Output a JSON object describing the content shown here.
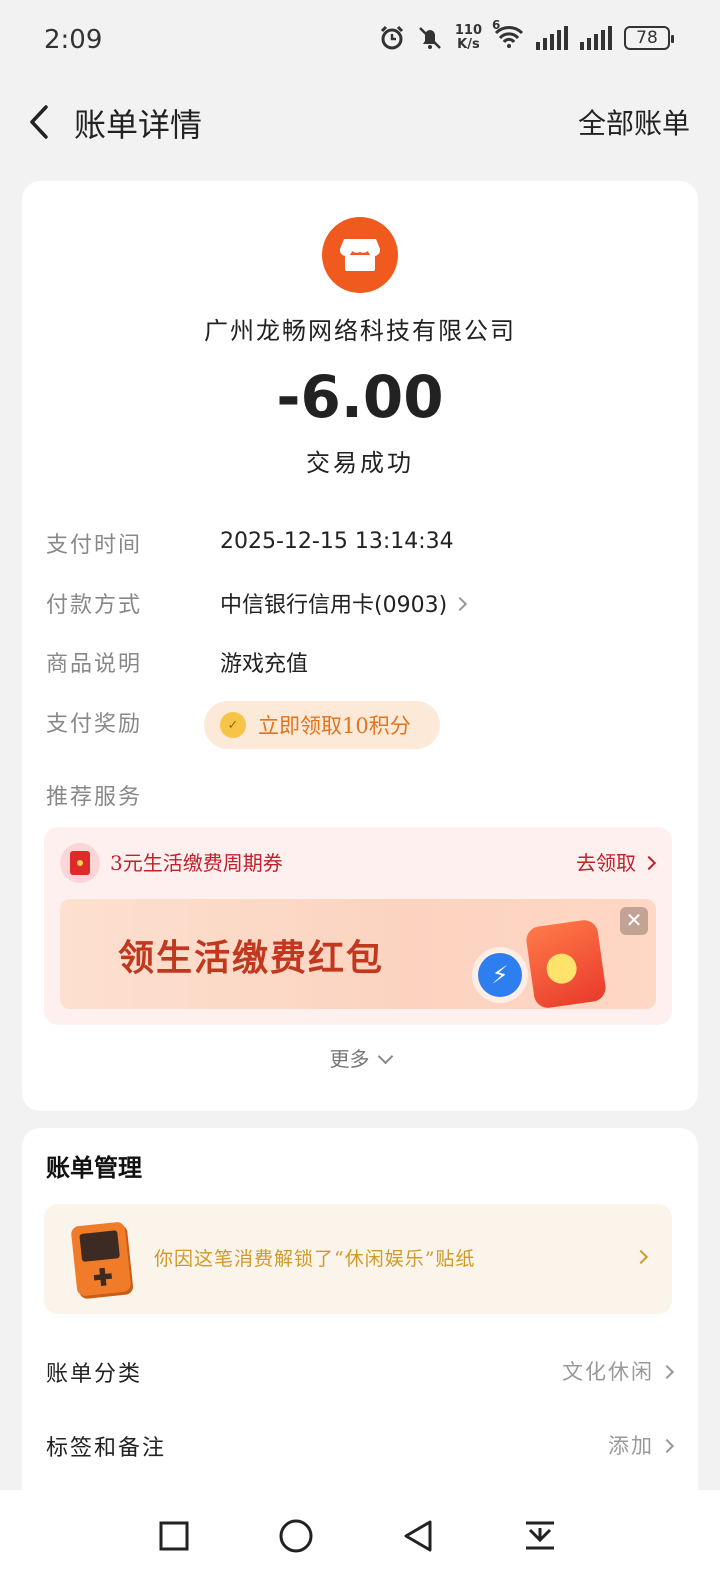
{
  "status_bar": {
    "time": "2:09",
    "net_speed_value": "110",
    "net_speed_unit": "K/s",
    "net_type": "6",
    "battery": "78"
  },
  "header": {
    "title": "账单详情",
    "all_bills": "全部账单"
  },
  "transaction": {
    "merchant": "广州龙畅网络科技有限公司",
    "amount": "-6.00",
    "status": "交易成功",
    "rows": [
      {
        "label": "支付时间",
        "value": "2025-12-15 13:14:34"
      },
      {
        "label": "付款方式",
        "value": "中信银行信用卡(0903)"
      },
      {
        "label": "商品说明",
        "value": "游戏充值"
      },
      {
        "label": "支付奖励",
        "value": "立即领取10积分"
      }
    ],
    "recommend_label": "推荐服务"
  },
  "promo": {
    "title": "3元生活缴费周期券",
    "action": "去领取",
    "banner_text": "领生活缴费红包"
  },
  "more": "更多",
  "management": {
    "title": "账单管理",
    "sticker_text": "你因这笔消费解锁了“休闲娱乐”贴纸",
    "rows": [
      {
        "label": "账单分类",
        "value": "文化休闲"
      },
      {
        "label": "标签和备注",
        "value": "添加"
      }
    ]
  },
  "colors": {
    "brand_orange": "#f05a1e",
    "promo_red": "#c0212a",
    "reward_orange": "#e2741e",
    "sticker_gold": "#d09a2a"
  }
}
